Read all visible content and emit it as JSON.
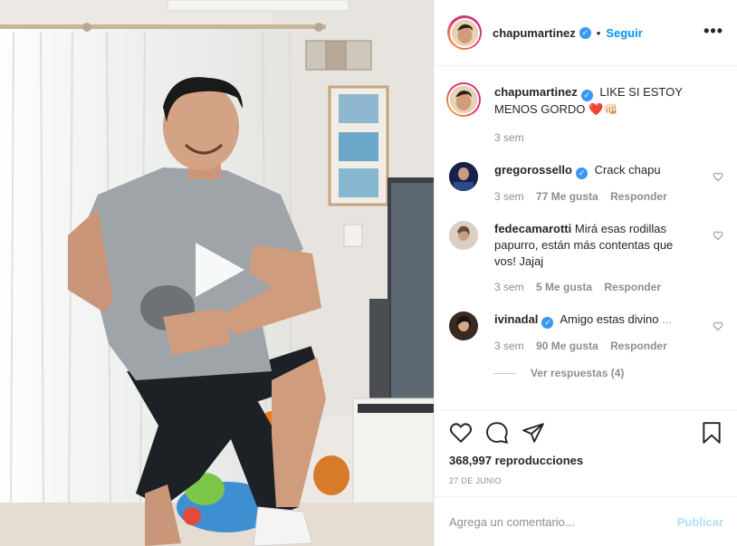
{
  "post": {
    "username": "chapumartinez",
    "follow_label": "Seguir",
    "dot": "•",
    "more_label": "•••"
  },
  "caption": {
    "username": "chapumartinez",
    "text": "LIKE SI ESTOY MENOS GORDO ❤️👊🏻",
    "time": "3 sem"
  },
  "comments": [
    {
      "username": "gregorossello",
      "verified": true,
      "text": "Crack chapu",
      "time": "3 sem",
      "likes": "77 Me gusta",
      "reply": "Responder"
    },
    {
      "username": "fedecamarotti",
      "verified": false,
      "text": "Mirá esas rodillas papurro, están más contentas que vos! Jajaj",
      "time": "3 sem",
      "likes": "5 Me gusta",
      "reply": "Responder"
    },
    {
      "username": "ivinadal",
      "verified": true,
      "text": "Amigo estas divino",
      "more": "...",
      "time": "3 sem",
      "likes": "90 Me gusta",
      "reply": "Responder",
      "view_replies": "Ver respuestas (4)"
    }
  ],
  "stats": {
    "views": "368,997 reproducciones",
    "date": "27 DE JUNIO"
  },
  "composer": {
    "placeholder": "Agrega un comentario...",
    "publish_label": "Publicar"
  },
  "colors": {
    "accent": "#0095f6",
    "verified": "#3897f0",
    "muted": "#8e8e8e",
    "publish_disabled": "#b2dffc"
  },
  "icons": [
    "play-icon",
    "verified-icon",
    "more-options-icon",
    "heart-icon",
    "comment-icon",
    "share-icon",
    "bookmark-icon"
  ]
}
